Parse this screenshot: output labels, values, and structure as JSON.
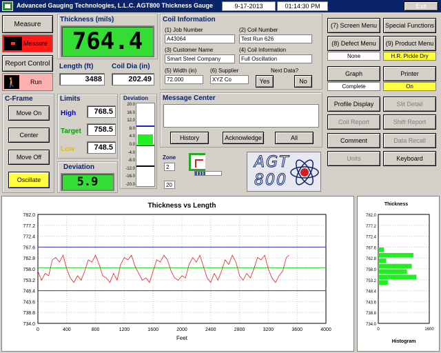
{
  "titlebar": {
    "app_title": "Advanced Gauging Technologies, L.L.C.   AGT800 Thickness Gauge",
    "date": "9-17-2013",
    "time": "01:14:30 PM",
    "exit": "Exit"
  },
  "left": {
    "measure": "Measure",
    "measure_ind": "Measure",
    "report_control": "Report Control",
    "run": "Run"
  },
  "thickness": {
    "label": "Thickness (mils)",
    "value": "764.4"
  },
  "length": {
    "label": "Length (ft)",
    "value": "3488"
  },
  "coil_dia": {
    "label": "Coil Dia (in)",
    "value": "202.49"
  },
  "cframe": {
    "title": "C-Frame",
    "move_on": "Move On",
    "center": "Center",
    "move_off": "Move Off",
    "oscillate": "Oscillate"
  },
  "limits": {
    "title": "Limits",
    "high_label": "High",
    "high": "768.5",
    "target_label": "Target",
    "target": "758.5",
    "low_label": "Low",
    "low": "748.5"
  },
  "deviation": {
    "title": "Deviation",
    "value": "5.9",
    "scale_title": "Deviation",
    "ticks": [
      "20.0",
      "16.0",
      "12.0",
      "8.0",
      "4.0",
      "0.0",
      "-4.0",
      "-8.0",
      "-12.0",
      "-16.0",
      "-20.0"
    ]
  },
  "coil": {
    "title": "Coil Information",
    "job_label": "(1) Job Number",
    "job": "A43064",
    "coil_label": "(2) Coil Number",
    "coil": "Test Run 626",
    "customer_label": "(3) Customer Name",
    "customer": "Smart Steel Company",
    "coilinfo_label": "(4) Coil Information",
    "coilinfo": "Full Oscillation",
    "width_label": "(5) Width (in)",
    "width": "72.000",
    "supplier_label": "(6) Supplier",
    "supplier": "XYZ Co",
    "next_label": "Next Data?",
    "yes": "Yes",
    "no": "No"
  },
  "message": {
    "title": "Message Center",
    "history": "History",
    "acknowledge": "Acknowledge",
    "all": "All"
  },
  "zone": {
    "label": "Zone",
    "value1": "2",
    "value2": "20"
  },
  "logo": {
    "line1": "AGT",
    "line2": "800"
  },
  "right": {
    "screen_menu": "(7) Screen Menu",
    "special": "Special Functions",
    "defect_menu": "(8) Defect Menu",
    "product_menu": "(9) Product Menu",
    "defect_status": "None",
    "product_status": "H.R. Pickle Dry",
    "graph": "Graph",
    "printer": "Printer",
    "graph_status": "Complete",
    "printer_status": "On",
    "profile": "Profile Display",
    "slit": "Slit Detail",
    "coil_report": "Coil Report",
    "shift_report": "Shift Report",
    "comment": "Comment",
    "data_recall": "Data Recall",
    "units": "Units",
    "keyboard": "Keyboard"
  },
  "chart_data": [
    {
      "type": "line",
      "title": "Thickness vs Length",
      "xlabel": "Feet",
      "ylabel": "",
      "xlim": [
        0,
        4000
      ],
      "ylim": [
        734.0,
        782.0
      ],
      "xticks": [
        0,
        400,
        800,
        1200,
        1600,
        2000,
        2400,
        2800,
        3200,
        3600,
        4000
      ],
      "yticks": [
        "782.0",
        "777.2",
        "772.4",
        "767.6",
        "762.8",
        "758.0",
        "753.2",
        "748.4",
        "743.6",
        "738.8",
        "734.0"
      ],
      "limits": {
        "high": 767.6,
        "target": 758.5,
        "low": 748.4
      },
      "series": [
        {
          "x": [
            0,
            50,
            100,
            150,
            200,
            250,
            300,
            350,
            400,
            450,
            500,
            550,
            600,
            650,
            700,
            750,
            800,
            850,
            900,
            950,
            1000,
            1050,
            1100,
            1150,
            1200,
            1250,
            1300,
            1350,
            1400,
            1450,
            1500,
            1550,
            1600,
            1650,
            1700,
            1750,
            1800,
            1850,
            1900,
            1950,
            2000,
            2050,
            2100,
            2150,
            2200,
            2250,
            2300,
            2350,
            2400,
            2450,
            2500,
            2550,
            2600,
            2650,
            2700,
            2750,
            2800,
            2850,
            2900,
            2950,
            3000,
            3050,
            3100,
            3150,
            3200,
            3250,
            3300,
            3350,
            3400,
            3450,
            3488
          ],
          "values": [
            757,
            753,
            756,
            755,
            762,
            763,
            761,
            764,
            758,
            754,
            752,
            755,
            753,
            757,
            762,
            761,
            764,
            760,
            755,
            754,
            752,
            756,
            753,
            760,
            763,
            762,
            764,
            759,
            756,
            753,
            754,
            752,
            757,
            762,
            761,
            764,
            762,
            757,
            754,
            753,
            755,
            754,
            760,
            763,
            761,
            764,
            759,
            754,
            752,
            756,
            753,
            757,
            762,
            760,
            764,
            761,
            755,
            753,
            756,
            754,
            758,
            763,
            762,
            764,
            758,
            754,
            752,
            755,
            757,
            763,
            764
          ]
        }
      ]
    },
    {
      "type": "bar",
      "orientation": "horizontal",
      "title": "Thickness",
      "xlabel": "Histogram",
      "xlim": [
        0,
        1600
      ],
      "yticks": [
        "782.0",
        "777.2",
        "772.4",
        "767.6",
        "762.8",
        "758.0",
        "753.2",
        "748.4",
        "743.6",
        "738.8",
        "734.0"
      ],
      "categories": [
        766.4,
        764.0,
        761.6,
        759.2,
        756.8,
        754.4,
        752.0
      ],
      "values": [
        180,
        1100,
        250,
        1050,
        900,
        1200,
        300
      ]
    }
  ]
}
